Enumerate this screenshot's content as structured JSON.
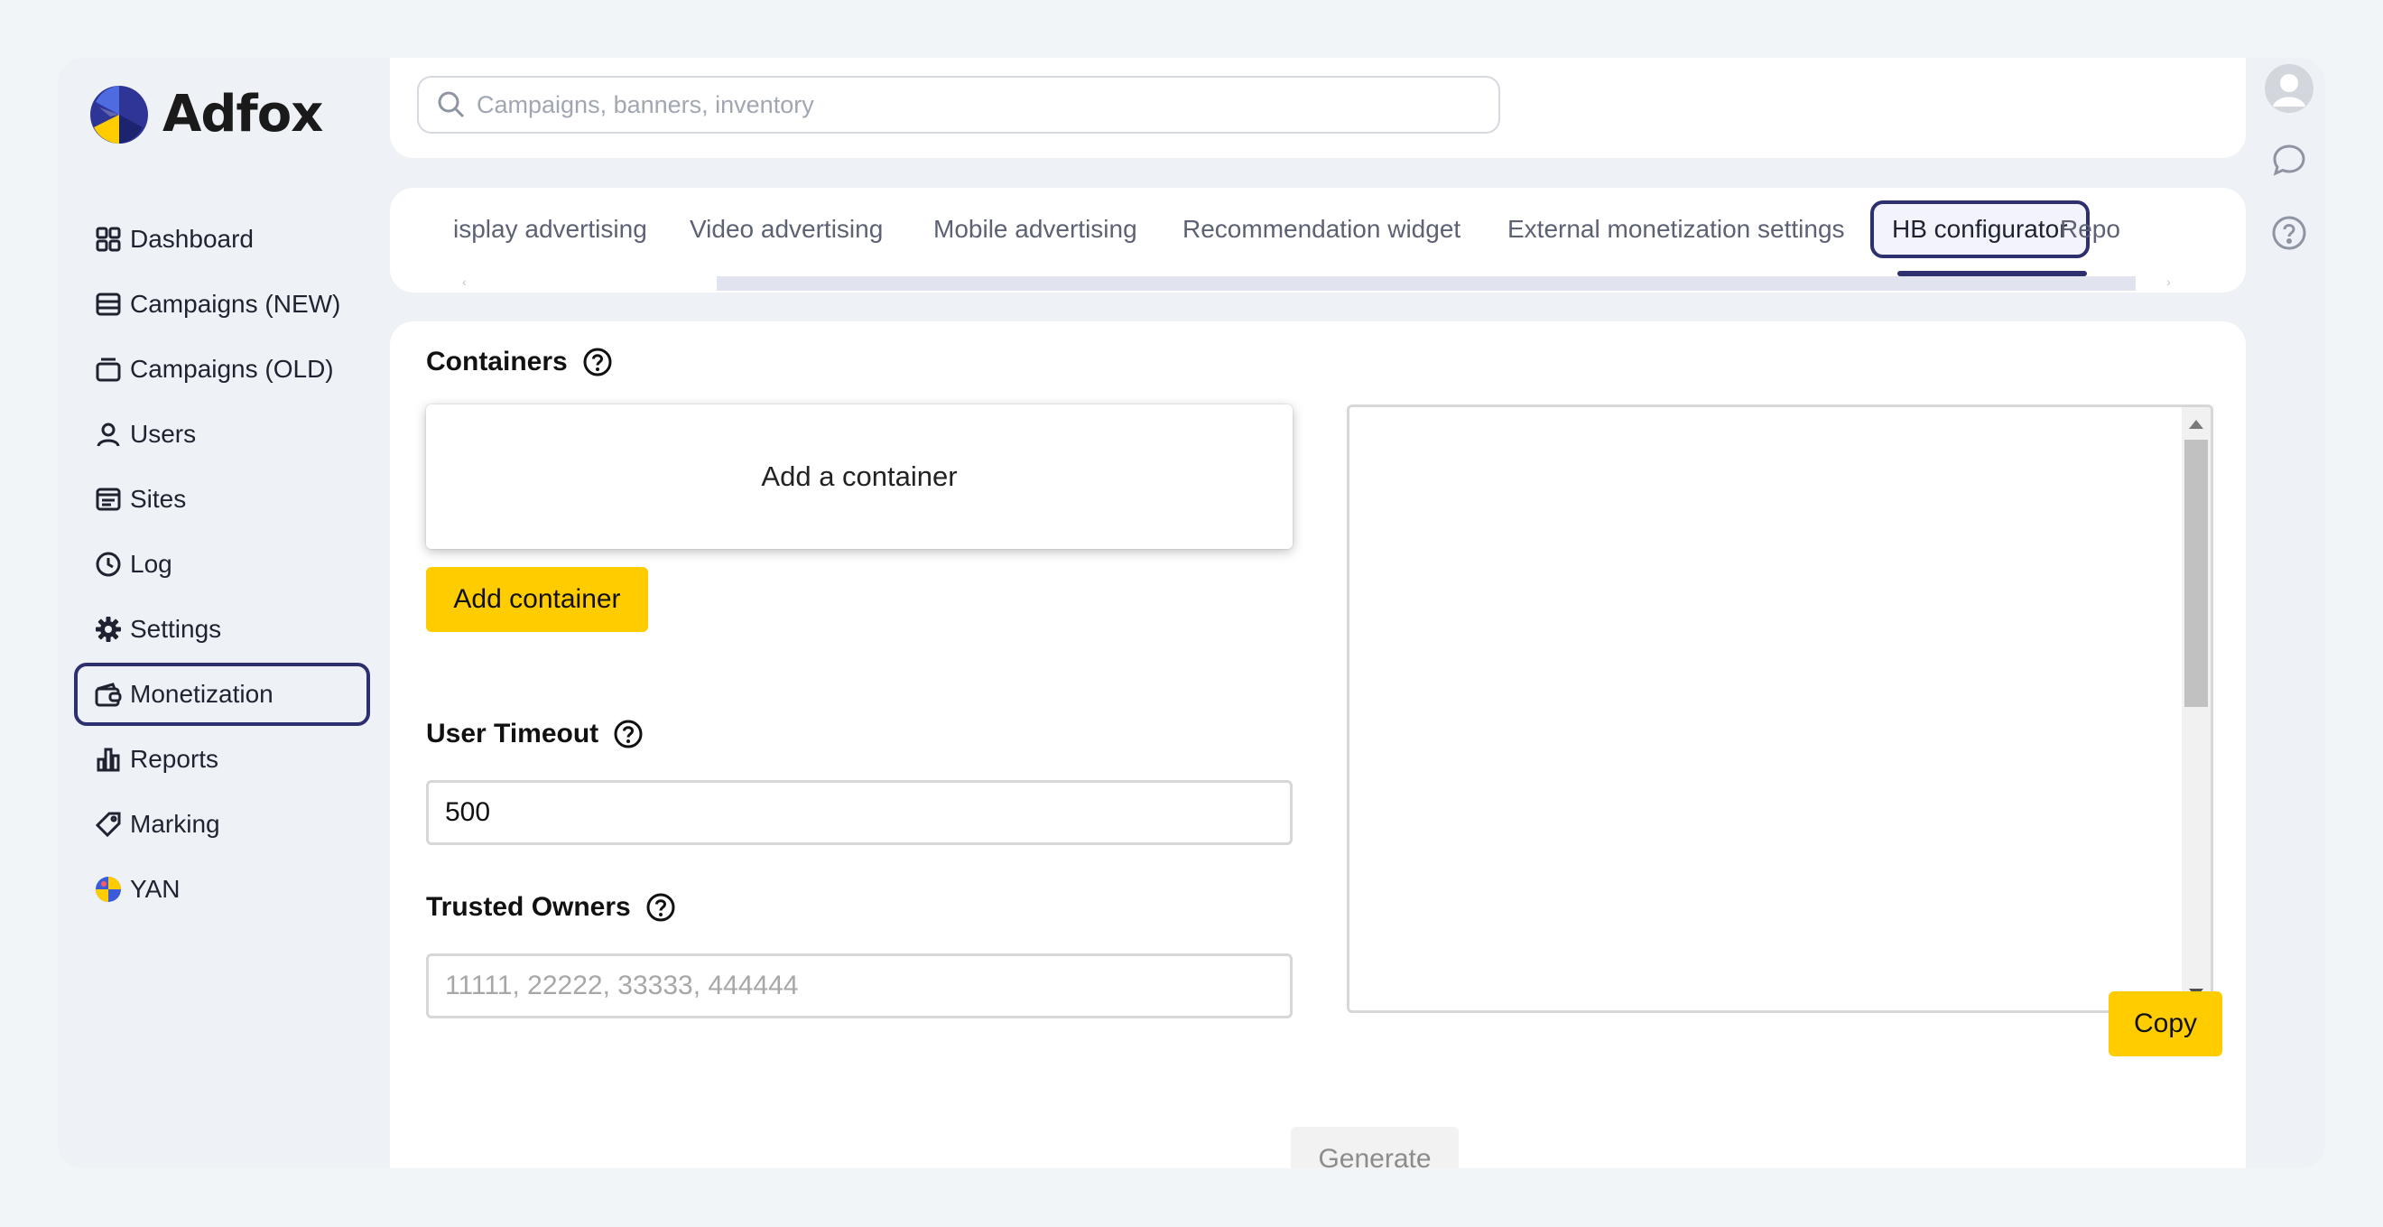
{
  "app": {
    "brand": "Adfox"
  },
  "sidebar": {
    "items": [
      {
        "label": "Dashboard",
        "icon": "dashboard-icon"
      },
      {
        "label": "Campaigns (NEW)",
        "icon": "campaigns-new-icon"
      },
      {
        "label": "Campaigns (OLD)",
        "icon": "campaigns-old-icon"
      },
      {
        "label": "Users",
        "icon": "user-icon"
      },
      {
        "label": "Sites",
        "icon": "sites-icon"
      },
      {
        "label": "Log",
        "icon": "clock-icon"
      },
      {
        "label": "Settings",
        "icon": "gear-icon"
      },
      {
        "label": "Monetization",
        "icon": "wallet-icon",
        "active": true
      },
      {
        "label": "Reports",
        "icon": "bar-chart-icon"
      },
      {
        "label": "Marking",
        "icon": "tag-icon"
      },
      {
        "label": "YAN",
        "icon": "yan-globe-icon"
      }
    ]
  },
  "search": {
    "placeholder": "Campaigns, banners, inventory",
    "value": ""
  },
  "tabs": [
    {
      "label": "isplay advertising"
    },
    {
      "label": "Video advertising"
    },
    {
      "label": "Mobile advertising"
    },
    {
      "label": "Recommendation widget"
    },
    {
      "label": "External monetization settings"
    },
    {
      "label": "HB configurator",
      "active": true
    },
    {
      "label": "Repo"
    }
  ],
  "main": {
    "containers_title": "Containers",
    "container_card_text": "Add a container",
    "add_container_label": "Add container",
    "user_timeout_title": "User Timeout",
    "user_timeout_value": "500",
    "trusted_owners_title": "Trusted Owners",
    "trusted_owners_placeholder": "11111, 22222, 33333, 444444",
    "trusted_owners_value": "",
    "code_output": "",
    "copy_label": "Copy",
    "generate_label": "Generate"
  },
  "colors": {
    "accent_yellow": "#ffcc00",
    "active_border": "#2d2f6f",
    "background": "#eef1f5"
  }
}
